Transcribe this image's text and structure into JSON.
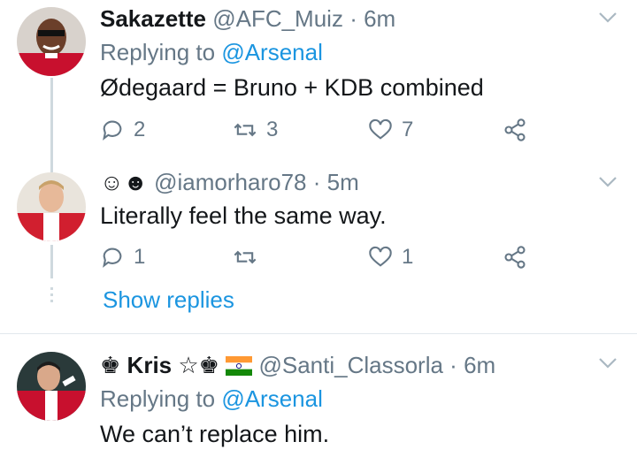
{
  "tweets": [
    {
      "name": "Sakazette",
      "handle": "@AFC_Muiz",
      "separator": "·",
      "time": "6m",
      "replying_prefix": "Replying to",
      "replying_to": "@Arsenal",
      "text": "Ødegaard = Bruno + KDB combined",
      "replies": "2",
      "retweets": "3",
      "likes": "7"
    },
    {
      "name": "☺☻",
      "handle": "@iamorharo78",
      "separator": "·",
      "time": "5m",
      "text": "Literally feel the same way.",
      "replies": "1",
      "retweets": "",
      "likes": "1"
    },
    {
      "name_prefix": "♚",
      "name": "Kris",
      "name_suffix": "☆♚",
      "flag": "india-flag",
      "handle": "@Santi_Classorla",
      "separator": "·",
      "time": "6m",
      "replying_prefix": "Replying to",
      "replying_to": "@Arsenal",
      "text": "We can’t replace him."
    }
  ],
  "show_replies": "Show replies",
  "colors": {
    "link": "#1b95e0",
    "muted": "#657786",
    "text": "#14171a",
    "thread": "#cfd9de"
  },
  "icons": [
    "reply-icon",
    "retweet-icon",
    "like-icon",
    "share-icon",
    "caret-down-icon"
  ]
}
